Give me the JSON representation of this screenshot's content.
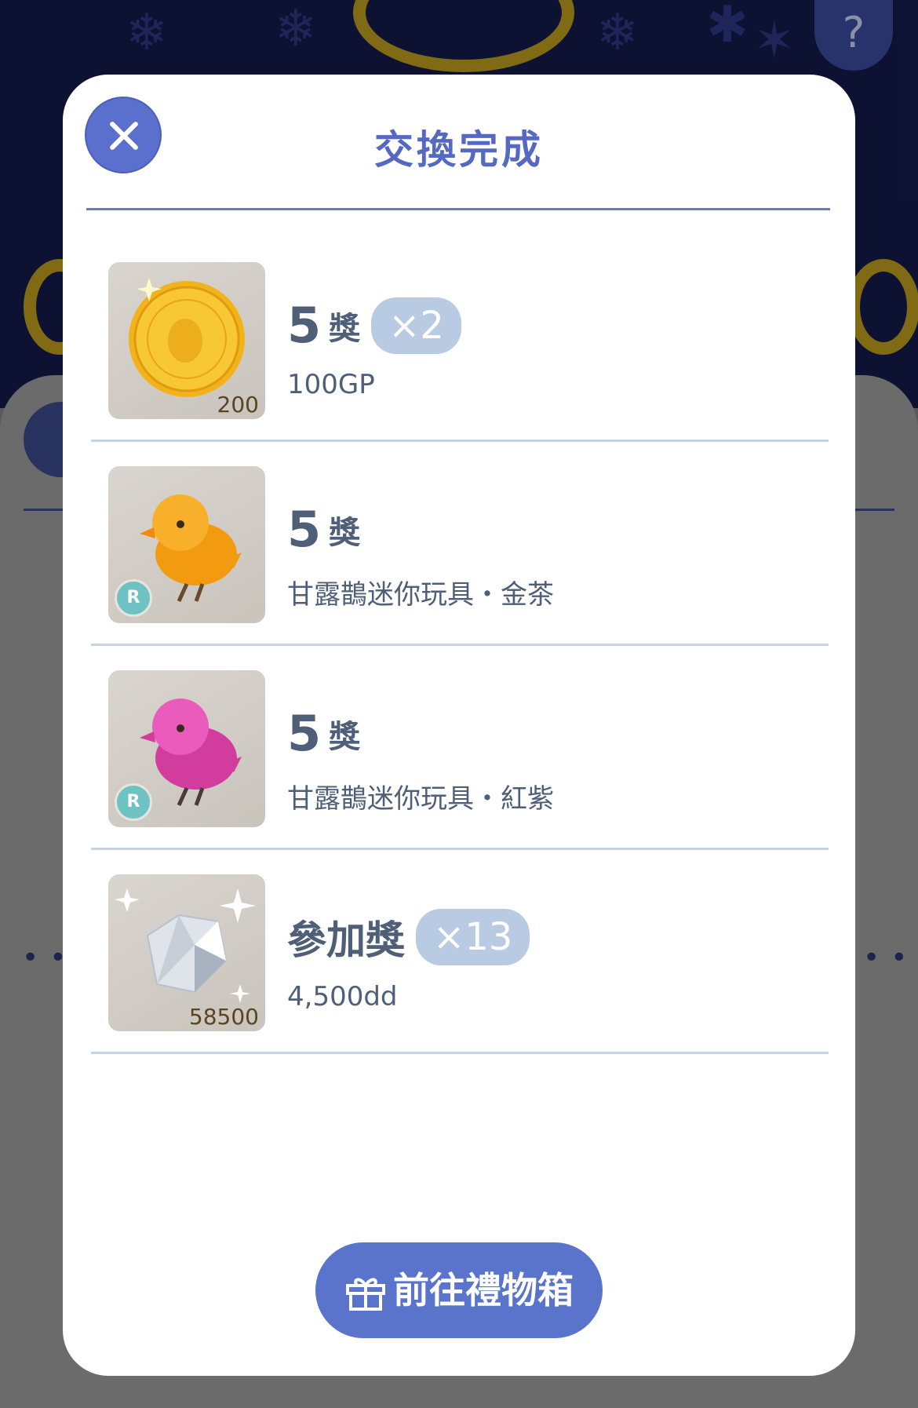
{
  "modal": {
    "title": "交換完成",
    "items": [
      {
        "prize_num": "5",
        "prize_label": "獎",
        "count": "×2",
        "description": "100GP",
        "quantity": "200",
        "image": "gold-coin",
        "rarity": ""
      },
      {
        "prize_num": "5",
        "prize_label": "獎",
        "count": "",
        "description": "甘露鵲迷你玩具・金茶",
        "quantity": "",
        "image": "orange-bird-toy",
        "rarity": "R"
      },
      {
        "prize_num": "5",
        "prize_label": "獎",
        "count": "",
        "description": "甘露鵲迷你玩具・紅紫",
        "quantity": "",
        "image": "pink-bird-toy",
        "rarity": "R"
      },
      {
        "prize_num": "",
        "prize_label": "參加獎",
        "count": "×13",
        "description": "4,500dd",
        "quantity": "58500",
        "image": "diamond",
        "rarity": ""
      }
    ],
    "gift_button_label": "前往禮物箱"
  },
  "background": {
    "help_label": "?"
  },
  "colors": {
    "accent": "#5a74cc",
    "title": "#5568c2",
    "text": "#4f5f78",
    "pill": "#b9cbe3",
    "rarity": "#6ec2c4",
    "night_bg": "#141a4a"
  }
}
